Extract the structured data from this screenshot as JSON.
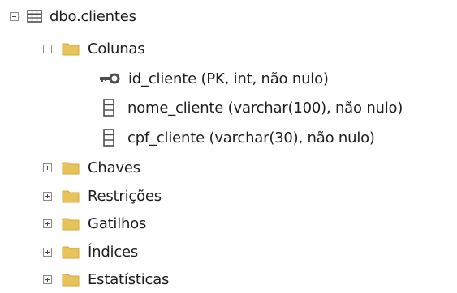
{
  "tree": {
    "table": {
      "label": "dbo.clientes",
      "icon": "table-icon",
      "expanded": true
    },
    "columns_folder": {
      "label": "Colunas",
      "icon": "folder-icon",
      "expanded": true
    },
    "columns": [
      {
        "label": "id_cliente (PK, int, não nulo)",
        "icon": "primary-key-icon"
      },
      {
        "label": "nome_cliente (varchar(100), não nulo)",
        "icon": "column-icon"
      },
      {
        "label": "cpf_cliente (varchar(30), não nulo)",
        "icon": "column-icon"
      }
    ],
    "folders": [
      {
        "label": "Chaves",
        "icon": "folder-icon",
        "expanded": false
      },
      {
        "label": "Restrições",
        "icon": "folder-icon",
        "expanded": false
      },
      {
        "label": "Gatilhos",
        "icon": "folder-icon",
        "expanded": false
      },
      {
        "label": "Índices",
        "icon": "folder-icon",
        "expanded": false
      },
      {
        "label": "Estatísticas",
        "icon": "folder-icon",
        "expanded": false
      }
    ]
  },
  "colors": {
    "folder": "#e8c35a",
    "folder_dark": "#d3a83f",
    "icon_gray": "#4d4d4d",
    "toggle_border": "#8c8c8c",
    "text": "#1e1e1e"
  }
}
